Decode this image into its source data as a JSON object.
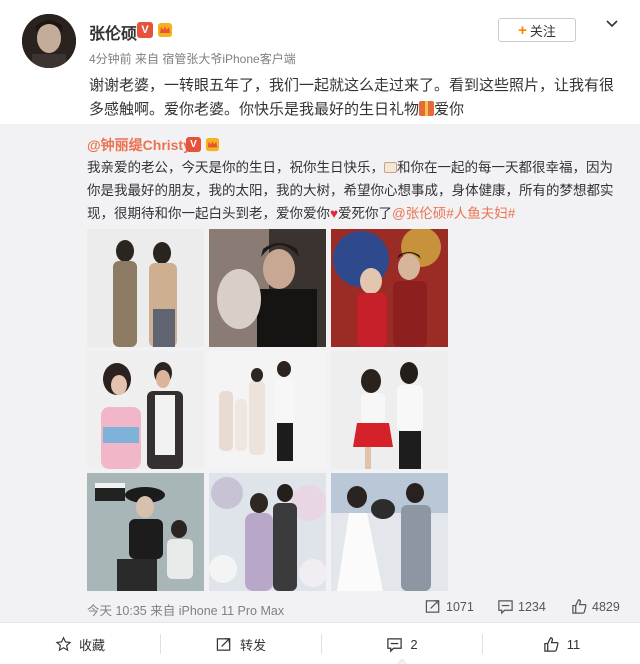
{
  "post": {
    "author": "张伦硕",
    "v_badge": "V",
    "meta": "4分钟前 来自 宿管张大爷iPhone客户端",
    "follow_label": "关注",
    "follow_plus": "+",
    "text_line1": "谢谢老婆，一转眼五年了，我们一起就这么走过来了。看到这些照片，让我有很",
    "text_line2a": "多感触啊。爱你老婆。你快乐是我最好的生日礼物",
    "text_line2b": "爱你"
  },
  "repost": {
    "author": "@钟丽缇Christy",
    "v_badge": "V",
    "text_part1": "我亲爱的老公，今天是你的生日，祝你生日快乐，",
    "text_part2": "和你在一起的每一天都很幸福，因为你是我最好的朋友，我的太阳，我的大树，希望你心想事成，身体健康，所有的梦想都实现，很期待和你一起白头到老，爱你爱你",
    "text_part3": "爱死你了",
    "mention": "@张伦硕",
    "hashtag": "#人鱼夫妇#",
    "time_source": "今天 10:35 来自 iPhone 11 Pro Max",
    "repost_count": "1071",
    "comment_count": "1234",
    "like_count": "4829",
    "photos": [
      {
        "name": "photo-couple-sequin-dress"
      },
      {
        "name": "photo-couple-close-embrace"
      },
      {
        "name": "photo-couple-red-chinese"
      },
      {
        "name": "photo-couple-colorful-dress"
      },
      {
        "name": "photo-family-group-white"
      },
      {
        "name": "photo-couple-red-skirt"
      },
      {
        "name": "photo-couple-film-clapper"
      },
      {
        "name": "photo-couple-hanfu-garden"
      },
      {
        "name": "photo-couple-wedding-dog"
      }
    ]
  },
  "actions": {
    "favorite_label": "收藏",
    "forward_label": "转发",
    "comment_count": "2",
    "like_count": "11"
  },
  "colors": {
    "accent": "#eb7350",
    "follow_plus": "#ff8200",
    "repost_bg": "#f2f2f5",
    "badge": "#e6533c"
  }
}
